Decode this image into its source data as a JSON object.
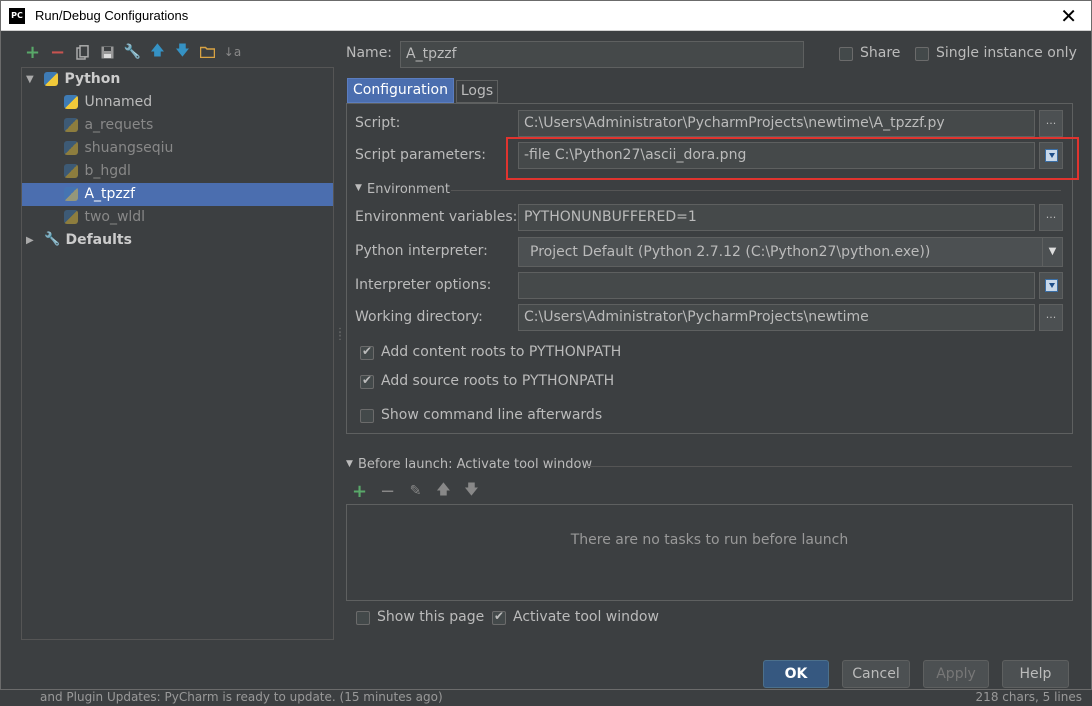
{
  "window": {
    "title": "Run/Debug Configurations",
    "icon_text": "PC"
  },
  "background": {
    "status_left": "and Plugin Updates: PyCharm is ready to update. (15 minutes ago)",
    "status_right": "218 chars, 5 lines"
  },
  "tree": {
    "python_group": "Python",
    "items": [
      {
        "label": "Unnamed",
        "faded": false
      },
      {
        "label": "a_requets",
        "faded": true
      },
      {
        "label": "shuangseqiu",
        "faded": true
      },
      {
        "label": "b_hgdl",
        "faded": true
      },
      {
        "label": "A_tpzzf",
        "faded": true,
        "selected": true
      },
      {
        "label": "two_wldl",
        "faded": true
      }
    ],
    "defaults_group": "Defaults"
  },
  "header": {
    "name_label": "Name:",
    "name_value": "A_tpzzf",
    "share_label": "Share",
    "single_instance_label": "Single instance only"
  },
  "tabs": [
    {
      "label": "Configuration",
      "active": true
    },
    {
      "label": "Logs",
      "active": false
    }
  ],
  "form": {
    "script_label": "Script:",
    "script_value": "C:\\Users\\Administrator\\PycharmProjects\\newtime\\A_tpzzf.py",
    "script_params_label": "Script parameters:",
    "script_params_value": "-file  C:\\Python27\\ascii_dora.png",
    "environment_section": "Environment",
    "env_vars_label": "Environment variables:",
    "env_vars_value": "PYTHONUNBUFFERED=1",
    "interpreter_label": "Python interpreter:",
    "interpreter_value": "Project Default (Python 2.7.12 (C:\\Python27\\python.exe))",
    "interp_options_label": "Interpreter options:",
    "interp_options_value": "",
    "working_dir_label": "Working directory:",
    "working_dir_value": "C:\\Users\\Administrator\\PycharmProjects\\newtime",
    "add_content_roots_label": "Add content roots to PYTHONPATH",
    "add_content_roots_checked": true,
    "add_source_roots_label": "Add source roots to PYTHONPATH",
    "add_source_roots_checked": true,
    "show_cmd_label": "Show command line afterwards",
    "show_cmd_checked": false,
    "dots": "..."
  },
  "before_launch": {
    "title": "Before launch: Activate tool window",
    "empty_text": "There are no tasks to run before launch"
  },
  "footer": {
    "show_page_label": "Show this page",
    "show_page_checked": false,
    "activate_tool_label": "Activate tool window",
    "activate_tool_checked": true,
    "ok": "OK",
    "cancel": "Cancel",
    "apply": "Apply",
    "help": "Help"
  },
  "colors": {
    "accent": "#4b6eaf",
    "highlight_annotation": "#e0342f",
    "add_green": "#59a869",
    "remove_red": "#c75450"
  }
}
